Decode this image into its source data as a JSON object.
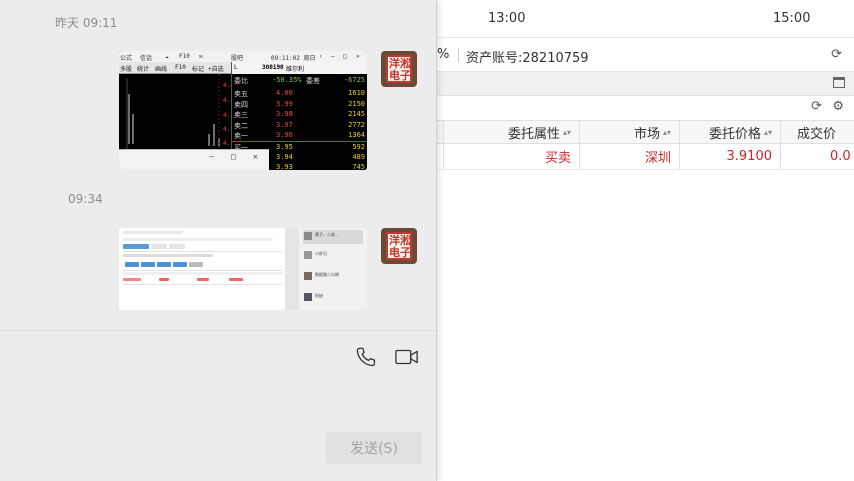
{
  "trade": {
    "times": [
      "13:00",
      "15:00"
    ],
    "pct_fragment": "%",
    "account_label": "资产账号:",
    "account_number": "28210759",
    "columns": [
      "委托属性",
      "市场",
      "委托价格",
      "成交价"
    ],
    "rows": [
      {
        "attr": "买卖",
        "market": "深圳",
        "price": "3.9100",
        "fill": "0.0"
      }
    ]
  },
  "chat": {
    "messages": [
      {
        "timestamp": "昨天 09:11",
        "image": {
          "toolbar": [
            "公式",
            "信话",
            "F10",
            "研发",
            "股吧"
          ],
          "clock": "09:11:02 周日",
          "subtabs": [
            "多股",
            "统计",
            "画线",
            "F10",
            "标记",
            "+自选",
            "返回"
          ],
          "header_code": "300190",
          "header_name": "维尔利",
          "ratio_label": "委比",
          "ratio_value": "-50.35%",
          "diff_label": "委差",
          "diff_value": "-6725",
          "price_labels": [
            "4.40",
            "4.35",
            "4.30",
            "4.25",
            "4.20",
            "4.15"
          ],
          "book": [
            {
              "level": "卖五",
              "price": "4.00",
              "vol": "1610"
            },
            {
              "level": "卖四",
              "price": "3.99",
              "vol": "2150"
            },
            {
              "level": "卖三",
              "price": "3.98",
              "vol": "2145"
            },
            {
              "level": "卖二",
              "price": "3.97",
              "vol": "2772"
            },
            {
              "level": "卖一",
              "price": "3.96",
              "vol": "1364"
            },
            {
              "level": "买一",
              "price": "3.95",
              "vol": "592"
            },
            {
              "level": "",
              "price": "3.94",
              "vol": "489"
            },
            {
              "level": "",
              "price": "3.93",
              "vol": "745"
            }
          ]
        }
      },
      {
        "timestamp": "09:34",
        "image": {
          "contacts": [
            "黄子、二老...",
            "小虾归",
            "数据猫二分期",
            "财迷"
          ]
        }
      }
    ],
    "avatar_chars": [
      "洋",
      "淞",
      "电",
      "子"
    ],
    "send_label": "发送(S)",
    "icons": [
      "phone-icon",
      "video-call-icon"
    ]
  }
}
